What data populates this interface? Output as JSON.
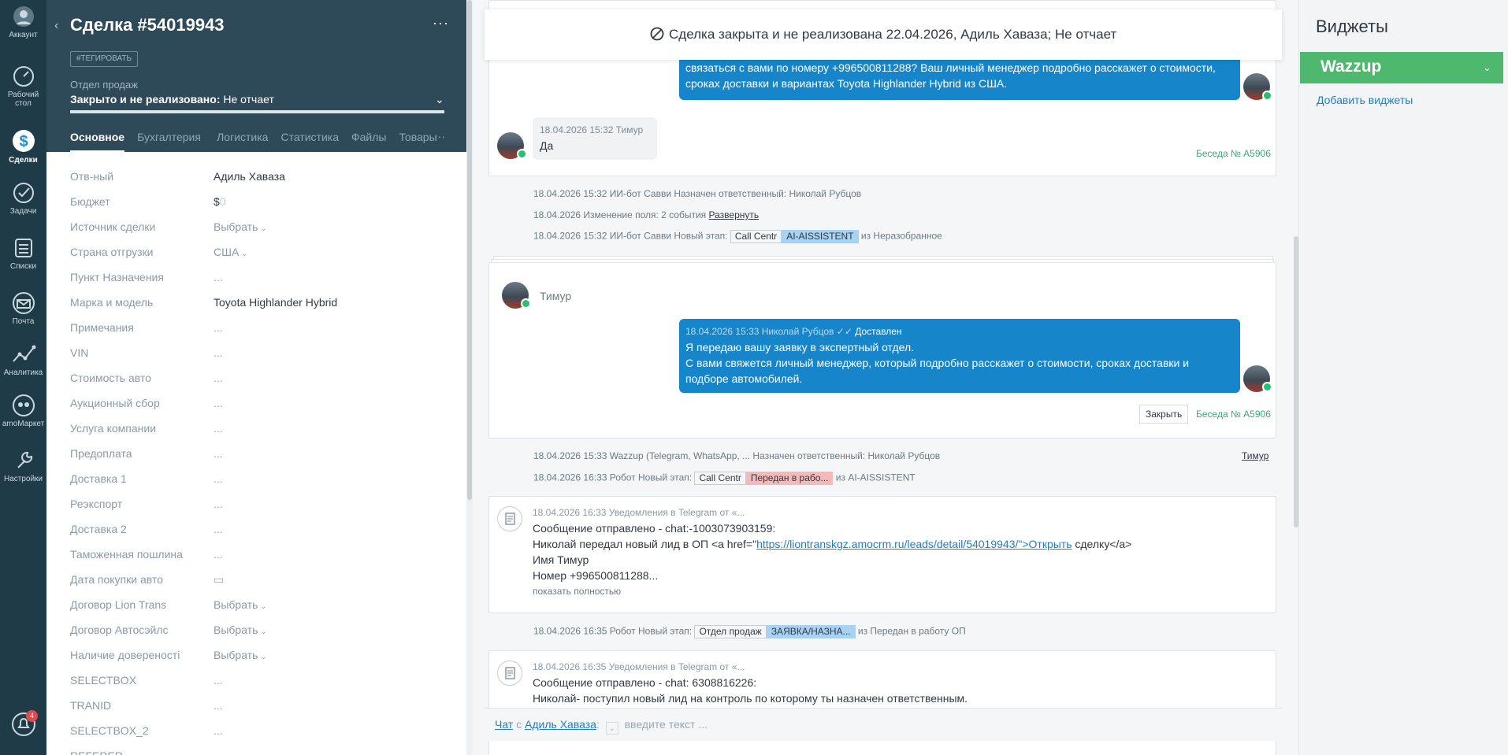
{
  "nav": {
    "items": [
      {
        "label": "Аккаунт",
        "icon": "avatar-icon"
      },
      {
        "label": "Рабочий стол",
        "line2": "стол",
        "line1": "Рабочий",
        "icon": "dashboard-icon"
      },
      {
        "label": "Сделки",
        "icon": "deals-icon",
        "active": true
      },
      {
        "label": "Задачи",
        "icon": "tasks-icon"
      },
      {
        "label": "Списки",
        "icon": "lists-icon"
      },
      {
        "label": "Почта",
        "icon": "mail-icon"
      },
      {
        "label": "Аналитика",
        "icon": "analytics-icon"
      },
      {
        "label": "amoМаркет",
        "icon": "market-icon"
      },
      {
        "label": "Настройки",
        "icon": "settings-icon"
      }
    ],
    "notifications_count": "4"
  },
  "card": {
    "title": "Сделка #54019943",
    "menu": "···",
    "tag_button": "#ТЕГИРОВАТЬ",
    "pipeline": "Отдел продаж",
    "status_bold": "Закрыто и не реализовано:",
    "status_reason": "Не отчает",
    "tabs": [
      "Основное",
      "Бухгалтерия",
      "Логистика",
      "Статистика",
      "Файлы",
      "Товары"
    ],
    "tabs_more": "···",
    "fields": [
      {
        "label": "Отв-ный",
        "value": "Адиль Хаваза"
      },
      {
        "label": "Бюджет",
        "value": "$",
        "extra": "0"
      },
      {
        "label": "Источник сделки",
        "value": "Выбрать",
        "select": true
      },
      {
        "label": "Страна отгрузки",
        "value": "США",
        "select": true
      },
      {
        "label": "Пункт Назначения",
        "value": "..."
      },
      {
        "label": "Марка и модель",
        "value": "Toyota Highlander Hybrid"
      },
      {
        "label": "Примечания",
        "value": "..."
      },
      {
        "label": "VIN",
        "value": "..."
      },
      {
        "label": "Стоимость авто",
        "value": "..."
      },
      {
        "label": "Аукционный сбор",
        "value": "..."
      },
      {
        "label": "Услуга компании",
        "value": "..."
      },
      {
        "label": "Предоплата",
        "value": "..."
      },
      {
        "label": "Доставка 1",
        "value": "..."
      },
      {
        "label": "Реэкспорт",
        "value": "..."
      },
      {
        "label": "Доставка 2",
        "value": "..."
      },
      {
        "label": "Таможенная пошлина",
        "value": "..."
      },
      {
        "label": "Дата покупки авто",
        "value": "▭"
      },
      {
        "label": "Договор Lion Trans",
        "value": "Выбрать",
        "select": true
      },
      {
        "label": "Договор Автосэйлс",
        "value": "Выбрать",
        "select": true
      },
      {
        "label": "Наличие довереності",
        "value": "Выбрать",
        "select": true
      },
      {
        "label": "SELECTBOX",
        "value": "..."
      },
      {
        "label": "TRANID",
        "value": "..."
      },
      {
        "label": "SELECTBOX_2",
        "value": "..."
      },
      {
        "label": "REFERER",
        "value": ""
      }
    ]
  },
  "banner": {
    "text": "Сделка закрыта и не реализована 22.04.2026, Адиль Хаваза; Не отчает"
  },
  "feed": {
    "msg1_line1": "связаться с вами по номеру +996500811288? Ваш личный менеджер подробно расскажет о стоимости,",
    "msg1_line2": "сроках доставки и вариантах Toyota Highlander Hybrid из США.",
    "msg2_meta": "18.04.2026 15:32 Тимур",
    "msg2_text": "Да",
    "conv1": "Беседа № A5906",
    "sys1": "18.04.2026 15:32 ИИ-бот Савви Назначен ответственный: Николай Рубцов",
    "sys2_prefix": "18.04.2026 Изменение поля: 2 события",
    "sys2_link": "Развернуть",
    "sys3_prefix": "18.04.2026 15:32 ИИ-бот Савви Новый этап:",
    "sys3_pill1": "Call Centr",
    "sys3_pill2": "AI-AISSISTENT",
    "sys3_suffix": "из Неразобранное",
    "chat2_name": "Тимур",
    "msg3_meta": "18.04.2026 15:33 Николай Рубцов",
    "msg3_status": "Доставлен",
    "msg3_line1": "Я передаю вашу заявку в экспертный отдел.",
    "msg3_line2": "С вами свяжется личный менеджер, который подробно расскажет о стоимости, сроках доставки и",
    "msg3_line3": "подборе автомобилей.",
    "close_btn": "Закрыть",
    "conv2": "Беседа № A5906",
    "sys4": "18.04.2026 15:33 Wazzup (Telegram, WhatsApp, ... Назначен ответственный: Николай Рубцов",
    "sys4_right": "Тимур",
    "sys5_prefix": "18.04.2026 16:33 Робот Новый этап:",
    "sys5_pill1": "Call Centr",
    "sys5_pill2": "Передан в рабо...",
    "sys5_suffix": "из AI-AISSISTENT",
    "note1_meta": "18.04.2026 16:33 Уведомления в Telegram от «...",
    "note1_l1": "Сообщение отправлено - chat:-1003073903159:",
    "note1_l2a": "Николай передал новый лид в ОП <a href=\"",
    "note1_l2link": "https://liontranskgz.amocrm.ru/leads/detail/54019943/\">Открыть",
    "note1_l2b": " сделку</a>",
    "note1_l3": "Имя Тимур",
    "note1_l4": "Номер +996500811288...",
    "note1_more": "показать полностью",
    "sys6_prefix": "18.04.2026 16:35 Робот Новый этап:",
    "sys6_pill1": "Отдел продаж",
    "sys6_pill2": "ЗАЯВКА/НАЗНА...",
    "sys6_suffix": "из Передан в работу ОП",
    "note2_meta": "18.04.2026 16:35 Уведомления в Telegram от «...",
    "note2_l1": "Сообщение отправлено - chat: 6308816226:",
    "note2_l2": "Николай- поступил новый лид на контроль по которому ты назначен ответственным."
  },
  "chat": {
    "mode": "Чат",
    "with": "с",
    "contact": "Адиль Хаваза",
    "placeholder": "введите текст ..."
  },
  "widgets": {
    "title": "Виджеты",
    "wazzup": "Wazzup",
    "add": "Добавить виджеты"
  },
  "colors": {
    "nav_bg": "#1f3b48",
    "card_head_bg": "#2e4a59",
    "bubble_out": "#1785c9",
    "accent_link": "#1f7ec4",
    "whatsapp_green": "#25c16f",
    "wazzup_green": "#4eb86e"
  }
}
